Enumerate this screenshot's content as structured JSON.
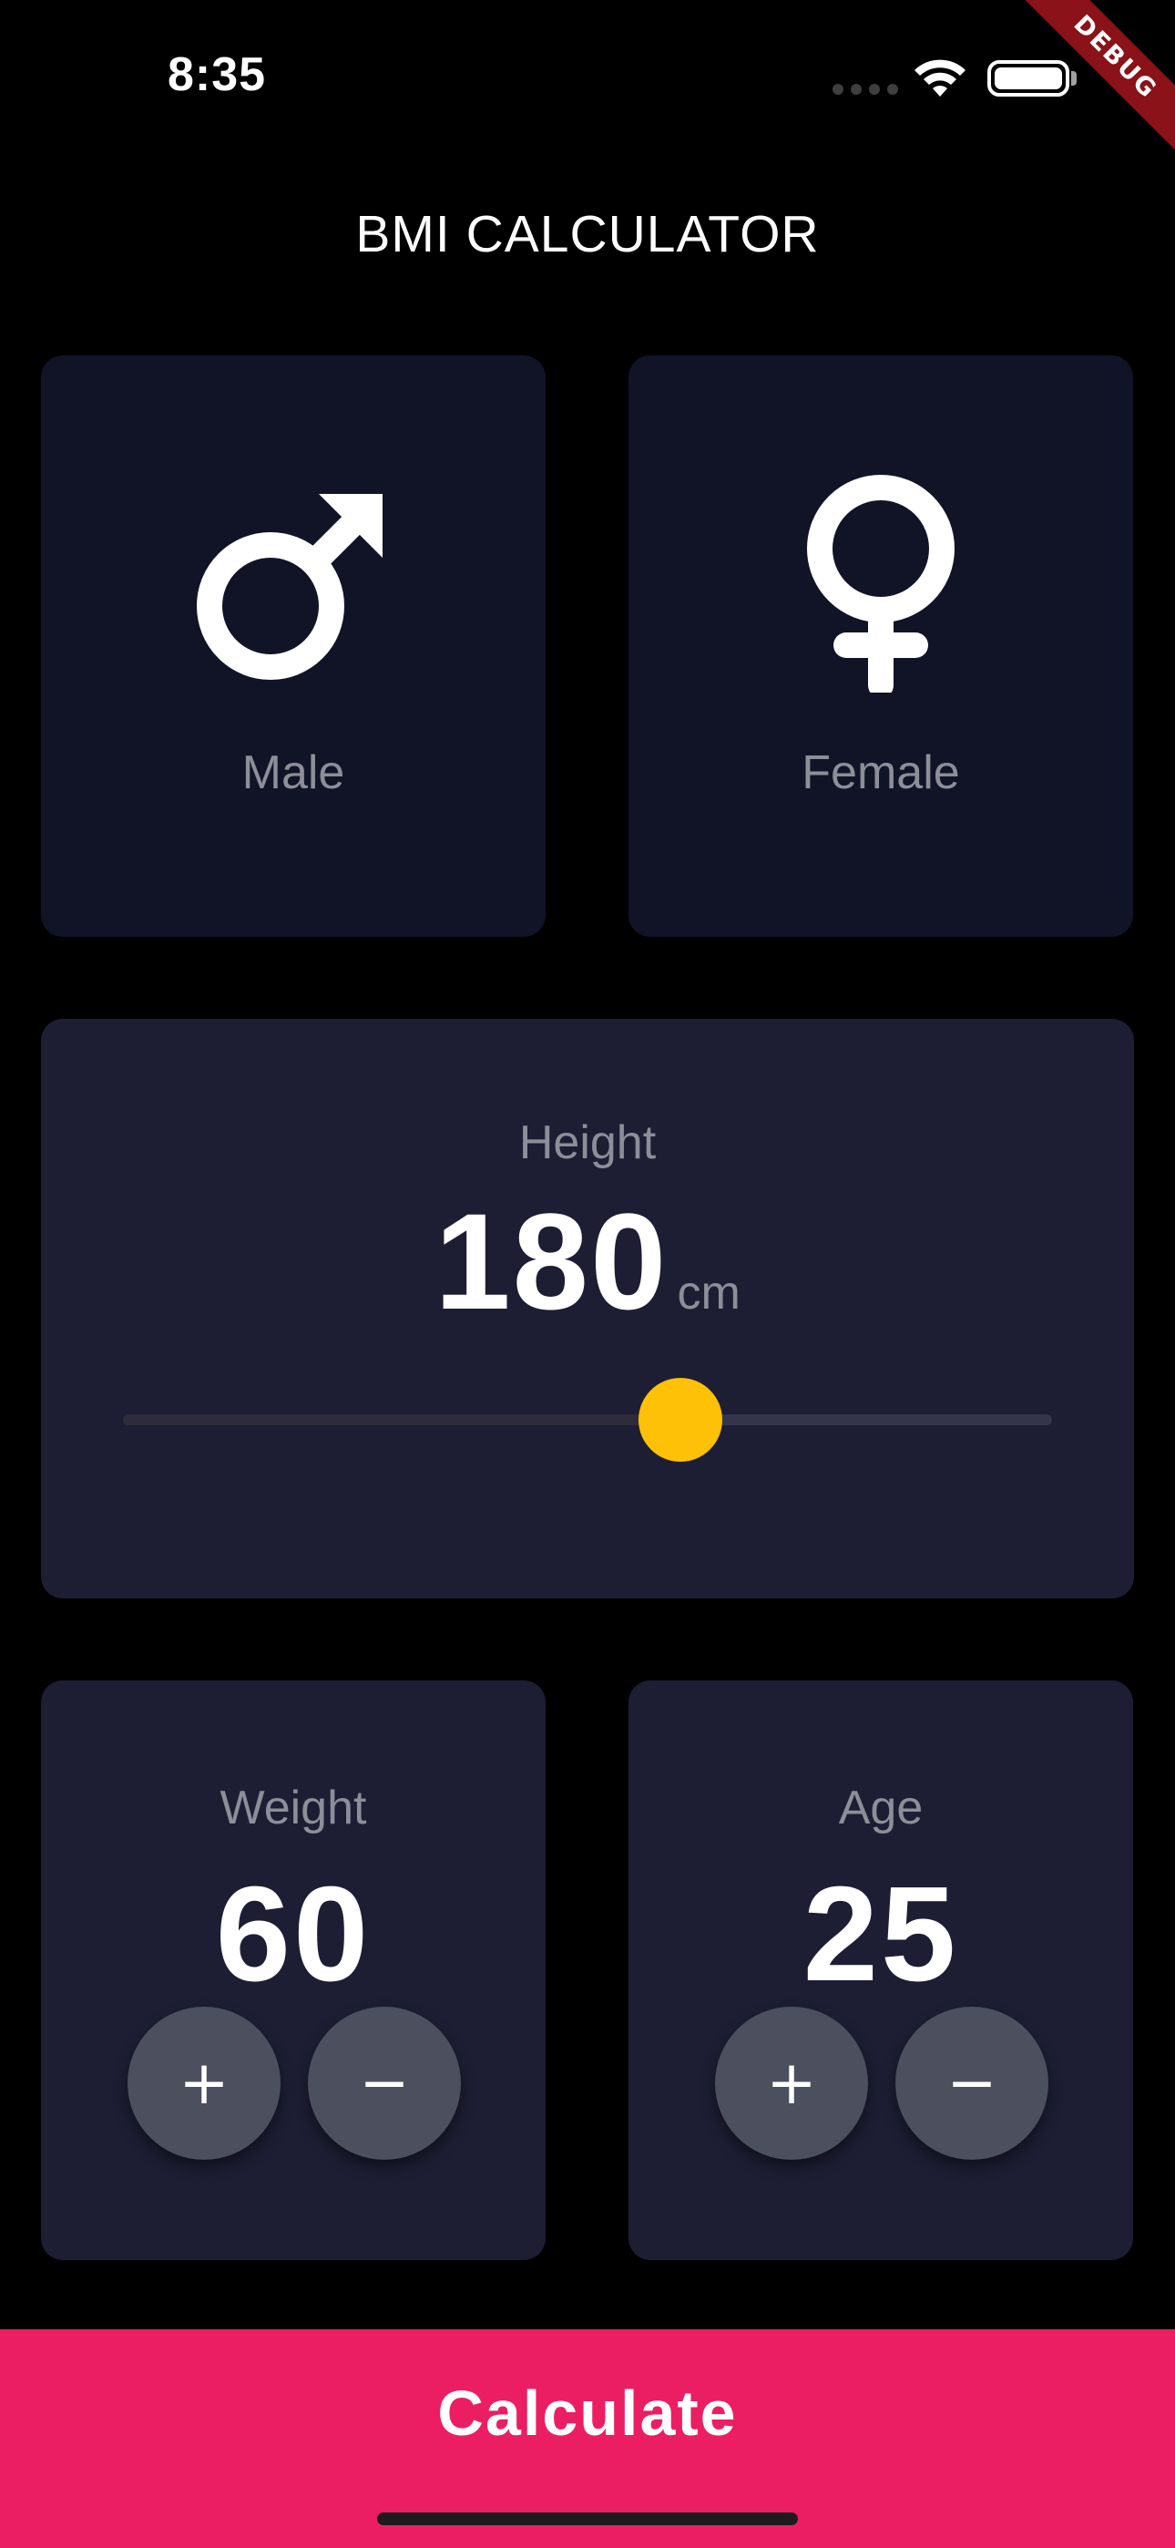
{
  "status_bar": {
    "time": "8:35",
    "debug_label": "DEBUG",
    "wifi_icon": "wifi-icon",
    "battery_icon": "battery-icon",
    "battery_level": 1.0
  },
  "app": {
    "title": "BMI CALCULATOR"
  },
  "gender": {
    "male": {
      "label": "Male",
      "icon": "male-icon"
    },
    "female": {
      "label": "Female",
      "icon": "female-icon"
    }
  },
  "height": {
    "label": "Height",
    "value": "180",
    "unit": "cm",
    "slider_fraction": 0.6
  },
  "weight": {
    "label": "Weight",
    "value": "60",
    "plus_label": "+",
    "minus_label": "−"
  },
  "age": {
    "label": "Age",
    "value": "25",
    "plus_label": "+",
    "minus_label": "−"
  },
  "calculate": {
    "label": "Calculate"
  },
  "colors": {
    "background": "#000000",
    "gender_card": "#111427",
    "active_card": "#1d1e33",
    "label_grey": "#8d8e98",
    "slider_thumb": "#ffc107",
    "round_button": "#4c4f5e",
    "accent": "#eb1e63",
    "debug_banner": "#8b1218"
  }
}
